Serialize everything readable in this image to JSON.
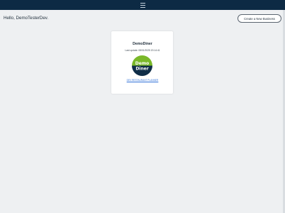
{
  "header": {
    "menu_icon": "hamburger-menu-icon"
  },
  "greeting": "Hello, DemoTesterDev.",
  "toolbar": {
    "create_label": "Create a New Business"
  },
  "business_card": {
    "name": "DemoDiner",
    "last_update": "Last update: 08/01/2025 20:14:41",
    "logo_line1": "Demo",
    "logo_line2": "Diner",
    "link_label": "DEV RESTAURANT PLANNER",
    "logo_colors": {
      "top": "#7ab829",
      "bottom": "#0f2d48"
    }
  },
  "colors": {
    "header_bg": "#0d2a44",
    "page_bg": "#eef0f2",
    "link": "#2e6fd8"
  }
}
